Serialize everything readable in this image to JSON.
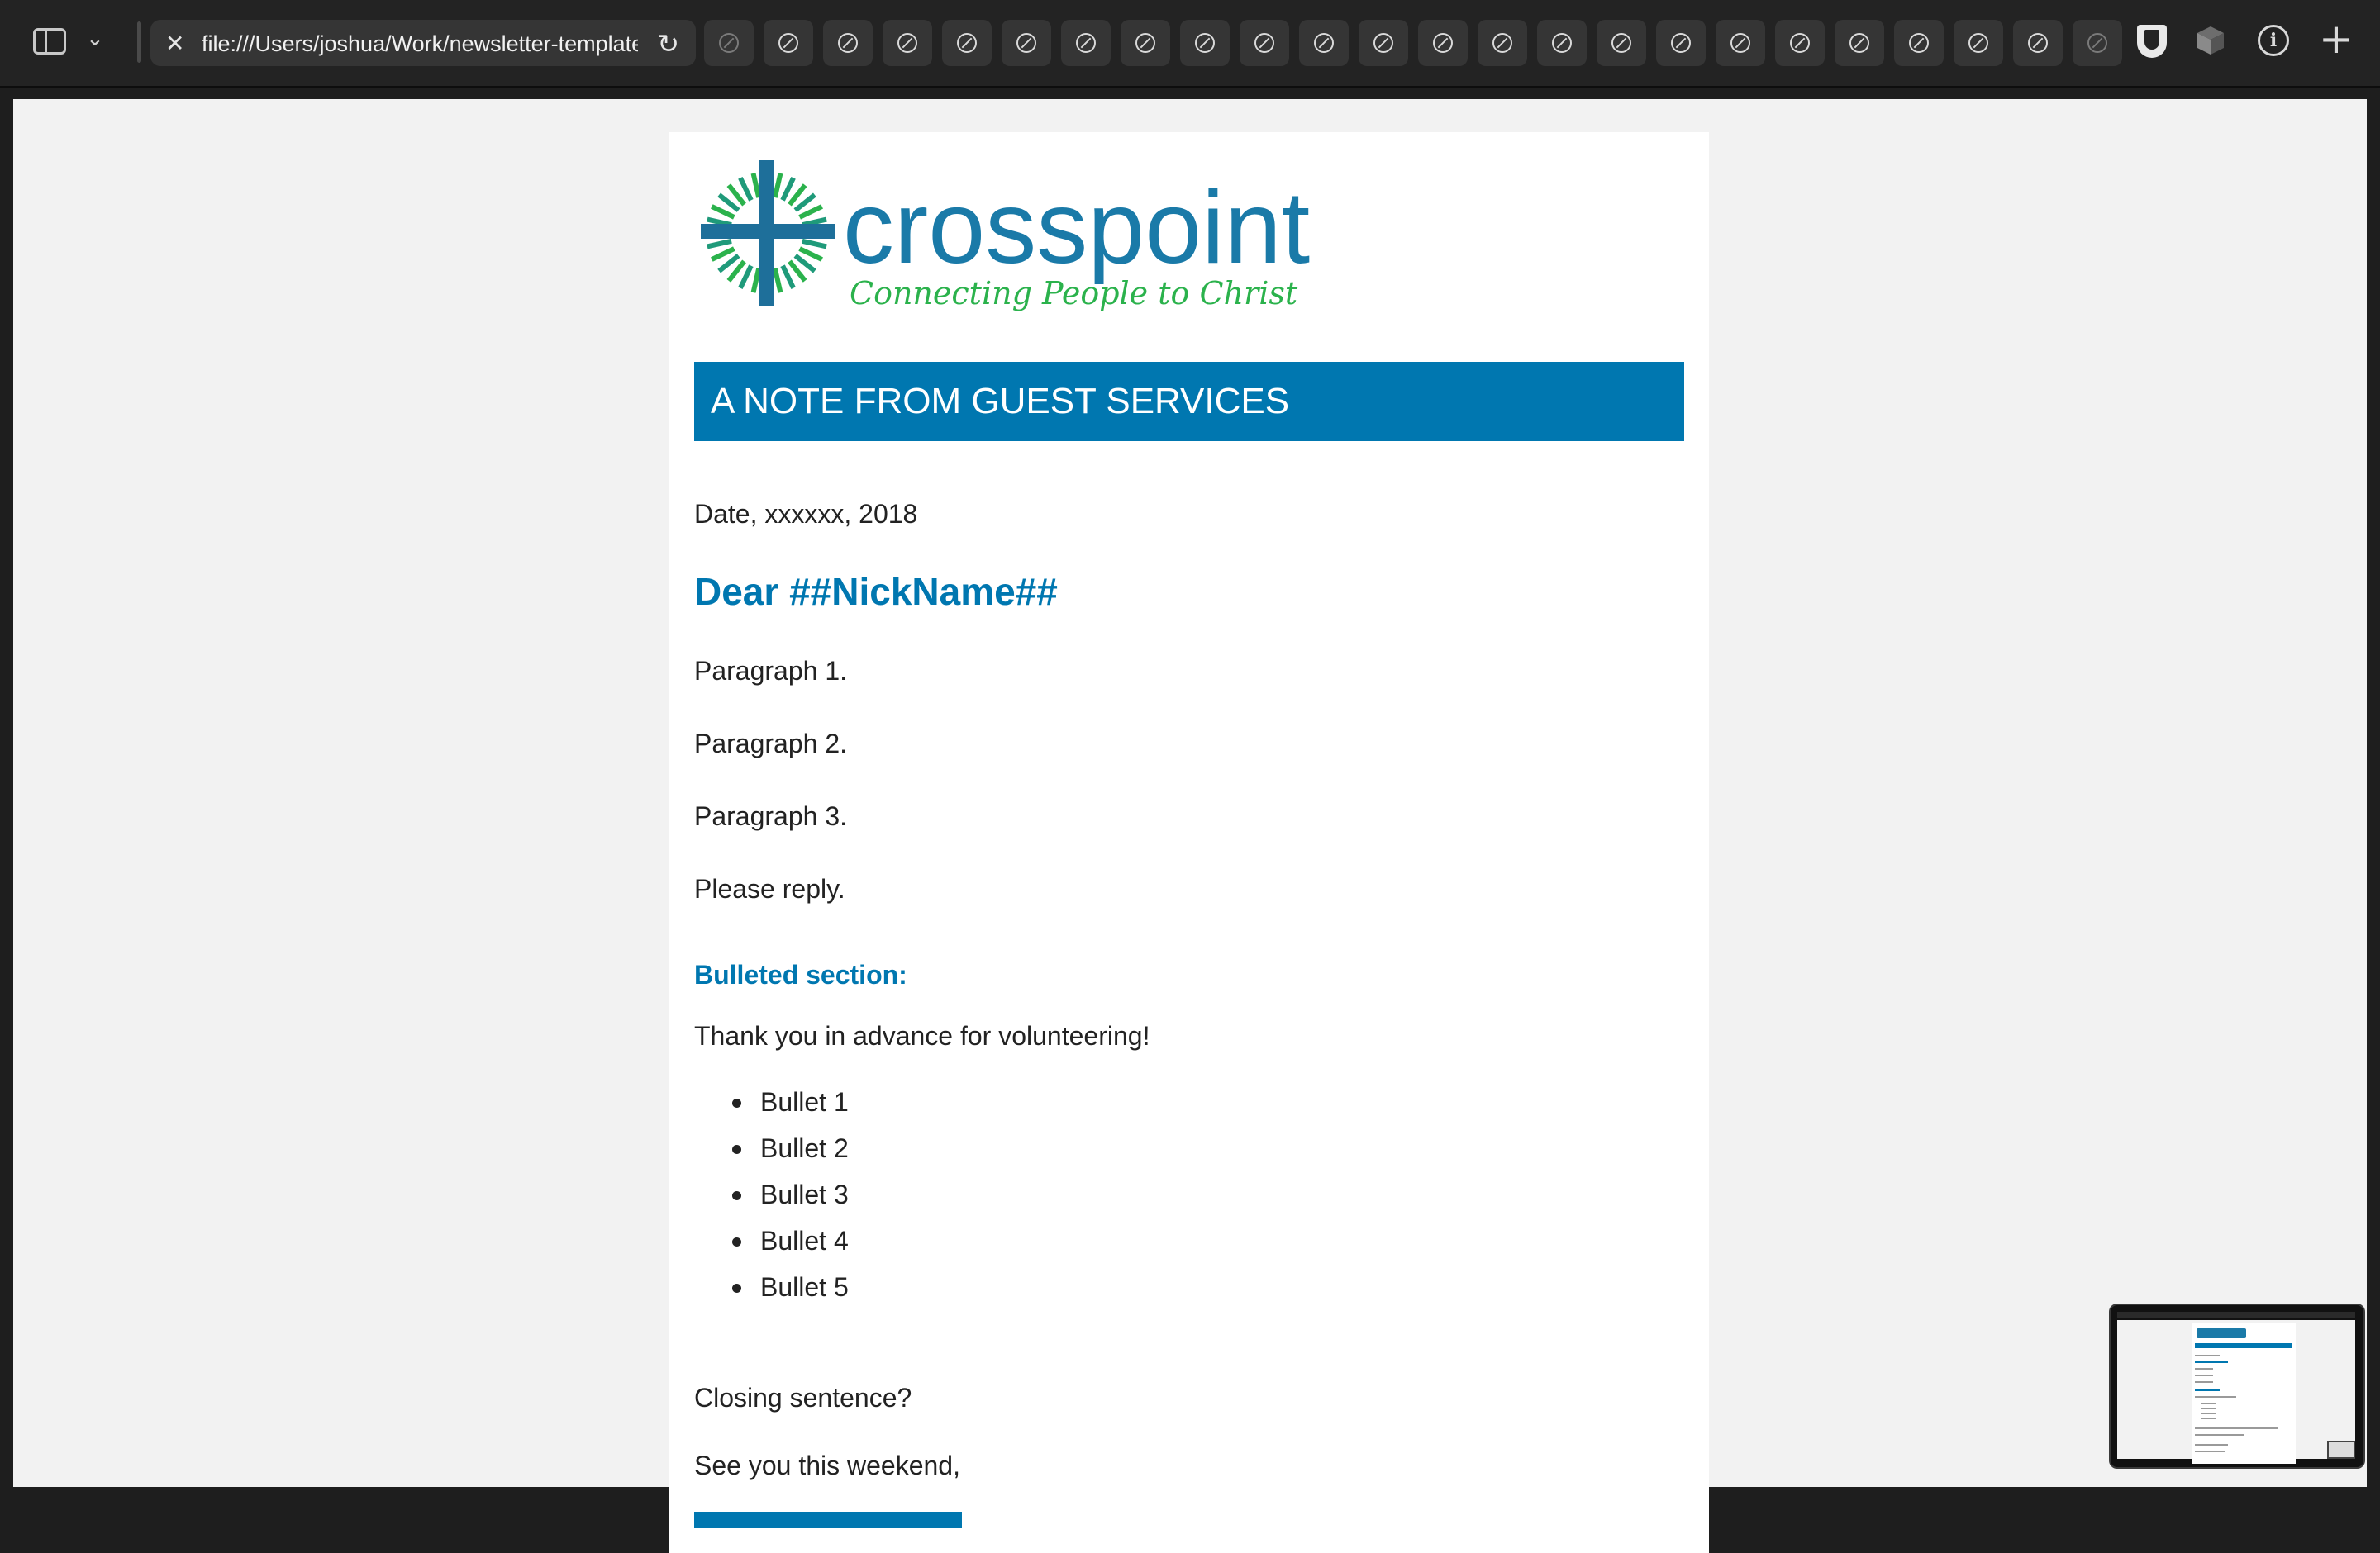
{
  "browser": {
    "url": "file:///Users/joshua/Work/newsletter-template.html",
    "tab_count": 24,
    "icons": [
      "sidebar-toggle-icon",
      "chevron-down-icon",
      "close-icon",
      "reload-icon",
      "compass-icon",
      "shield-icon",
      "cube-icon",
      "info-icon",
      "plus-icon"
    ]
  },
  "email": {
    "logo": {
      "wordmark": "crosspoint",
      "tagline": "Connecting People to Christ"
    },
    "banner_title": "A NOTE FROM GUEST SERVICES",
    "date_line": "Date, xxxxxx, 2018",
    "greeting": "Dear ##NickName##",
    "paragraphs": [
      "Paragraph 1.",
      "Paragraph 2.",
      "Paragraph 3.",
      "Please reply."
    ],
    "section_heading": "Bulleted section:",
    "section_intro": "Thank you in advance for volunteering!",
    "bullets": [
      "Bullet 1",
      "Bullet 2",
      "Bullet 3",
      "Bullet 4",
      "Bullet 5"
    ],
    "closing": "Closing sentence?",
    "signoff": "See you this weekend,"
  },
  "colors": {
    "brand_blue": "#0077b0",
    "brand_green": "#2bb24c",
    "toolbar_bg": "#232323",
    "page_bg": "#f2f2f2"
  }
}
